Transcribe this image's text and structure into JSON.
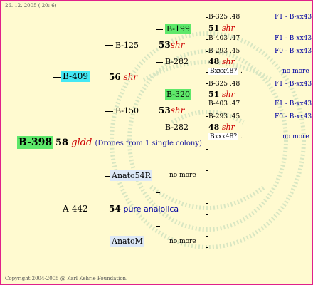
{
  "header": {
    "date": "26. 12. 2005 ( 20: 6)"
  },
  "footer": {
    "copyright": "Copyright 2004-2005 @ Karl Kehrle Foundation."
  },
  "root": {
    "id": "B-398",
    "num": "58",
    "code": "gldd",
    "note": "(Drones from 1 single colony)"
  },
  "dam": {
    "id": "B-409",
    "num": "56",
    "code": "shr"
  },
  "sire": {
    "id": "A-442",
    "num": "54",
    "line": "pure analolica"
  },
  "gen3": {
    "b125": "B-125",
    "b150": "B-150",
    "anato54r": "Anato54R",
    "anatom": "AnatoM"
  },
  "gen4": {
    "b199": "B-199",
    "b282a": "B-282",
    "b320": "B-320",
    "b282b": "B-282",
    "nomore1": "no more",
    "nomore2": "no more"
  },
  "shr53": {
    "num": "53",
    "code": "shr"
  },
  "gen5": {
    "r1": {
      "id": "B-325",
      "val": ".48",
      "f": "F1 - B-xx43"
    },
    "r2": {
      "num": "51",
      "code": "shr"
    },
    "r3": {
      "id": "B-403",
      "val": ".47",
      "f": "F1 - B-xx43"
    },
    "r4": {
      "id": "B-293",
      "val": ".45",
      "f": "F0 - B-xx43"
    },
    "r5": {
      "num": "48",
      "code": "shr"
    },
    "r6": {
      "id": "Bxxx48?",
      "val": ".",
      "f": "no more"
    }
  }
}
